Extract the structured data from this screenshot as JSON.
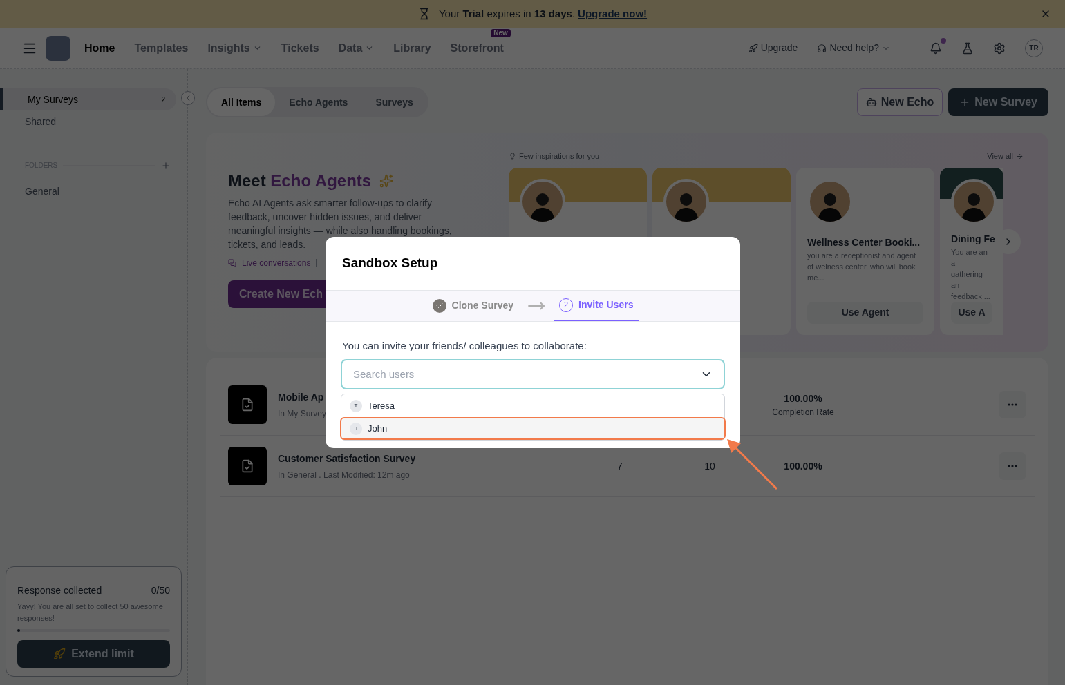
{
  "banner": {
    "message": "Your **Trial** expires in **13 days**.",
    "link": "Upgrade now!"
  },
  "nav": {
    "links": [
      {
        "label": "Home",
        "selected": true,
        "dropdown": false
      },
      {
        "label": "Templates",
        "selected": false,
        "dropdown": false
      },
      {
        "label": "Insights",
        "selected": false,
        "dropdown": true
      },
      {
        "label": "Tickets",
        "selected": false,
        "dropdown": false
      },
      {
        "label": "Data",
        "selected": false,
        "dropdown": true
      },
      {
        "label": "Library",
        "selected": false,
        "dropdown": false
      },
      {
        "label": "Storefront",
        "selected": false,
        "dropdown": false,
        "badge": "New"
      }
    ],
    "upgrade": "Upgrade",
    "help": "Need help?",
    "notification": true,
    "avatar": "TR"
  },
  "sidebar": {
    "items": [
      {
        "label": "My Surveys",
        "count": "2",
        "selected": true
      },
      {
        "label": "Shared",
        "selected": false
      }
    ],
    "folders_heading": "FOLDERS",
    "folders": [
      "General"
    ],
    "usage": {
      "title": "Response collected",
      "count": "0/50",
      "note": "Yayy! You are all set to collect 50 awesome responses!",
      "level": 0.01,
      "button": "Extend limit"
    }
  },
  "tabs": [
    {
      "label": "All Items",
      "selected": true
    },
    {
      "label": "Echo Agents",
      "selected": false
    },
    {
      "label": "Surveys",
      "selected": false
    }
  ],
  "actions": {
    "new_echo": "New Echo",
    "new_survey": "New Survey"
  },
  "hero": {
    "title_lead": "Meet",
    "title_accent": "Echo Agents",
    "description": "Echo AI Agents ask smarter follow-ups to clarify feedback, uncover hidden issues, and deliver meaningful insights — while also handling bookings, tickets, and leads.",
    "feature": "Live conversations",
    "button": "Create New Ech"
  },
  "inspirations": {
    "heading": "Few inspirations for you",
    "view_all": "View all",
    "cards": [
      {
        "kind": "covered"
      },
      {
        "kind": "covered"
      },
      {
        "kind": "full",
        "title": "Wellness Center Booki...",
        "lines": [
          "you are a receptionist and agent of welness center, who will book me..."
        ],
        "button": "Use Agent"
      },
      {
        "kind": "partial",
        "title": "Dining Fe",
        "lines": [
          "You are an a",
          "gathering an",
          "feedback ..."
        ],
        "button": "Use A"
      }
    ]
  },
  "surveys": [
    {
      "name": "Mobile Ap",
      "meta": "In My Survey",
      "rate": "100.00%",
      "rate_label": "Completion Rate"
    },
    {
      "name": "Customer Satisfaction Survey",
      "meta": "In General . Last Modified: 12m ago",
      "col_3": "7",
      "col_4": "10",
      "rate": "100.00%"
    }
  ],
  "modal": {
    "title": "Sandbox Setup",
    "steps": [
      {
        "label": "Clone Survey",
        "done": true,
        "selected": false
      },
      {
        "label": "Invite Users",
        "number": "2",
        "done": false,
        "selected": true
      }
    ],
    "prompt": "You can invite your friends/ colleagues to collaborate:",
    "search": {
      "placeholder": "Search users"
    },
    "options": [
      {
        "initial": "T",
        "name": "Teresa",
        "highlighted": false
      },
      {
        "initial": "J",
        "name": "John",
        "highlighted": true
      }
    ]
  }
}
